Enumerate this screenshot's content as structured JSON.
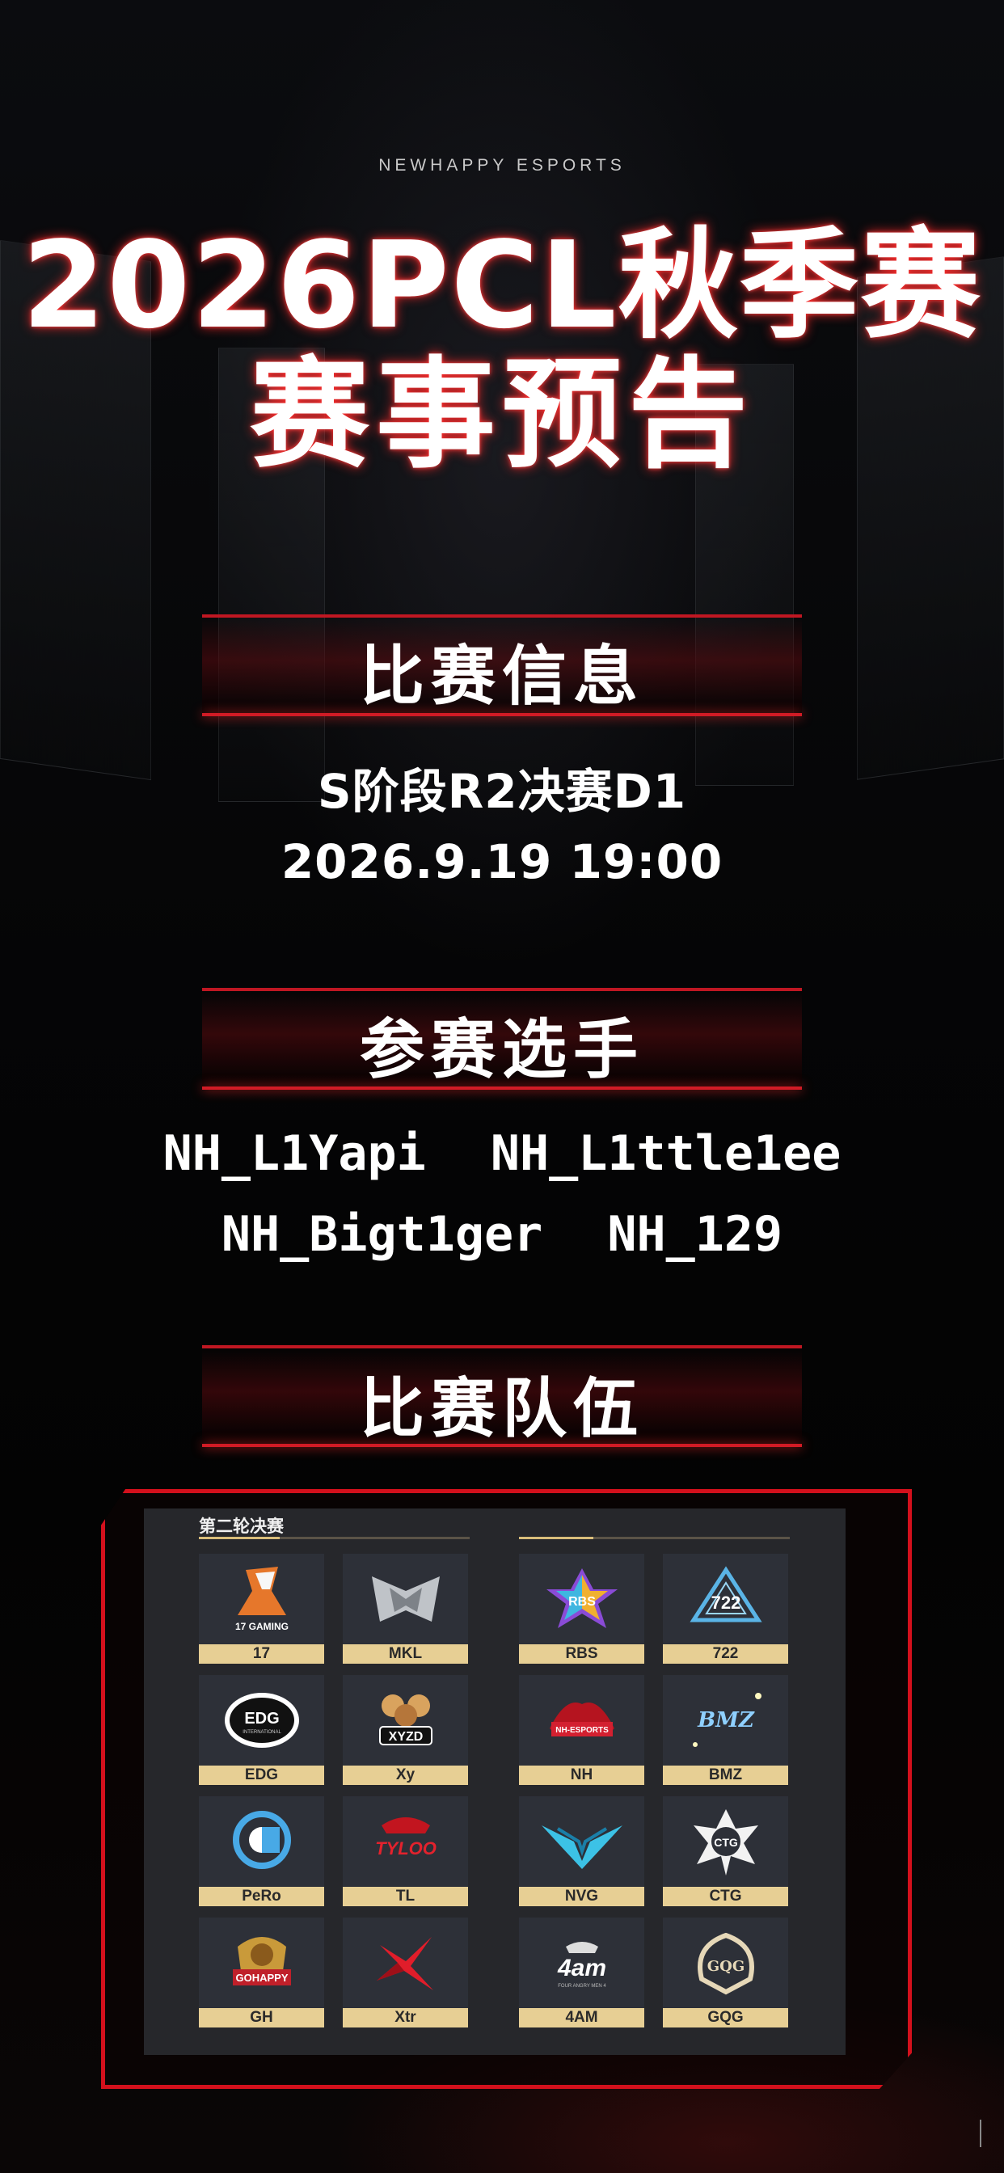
{
  "brand": "NEWHAPPY ESPORTS",
  "title_line1": "2026PCL秋季赛",
  "title_line2": "赛事预告",
  "section_info": {
    "title": "比赛信息",
    "stage": "S阶段R2决赛D1",
    "datetime": "2026.9.19 19:00"
  },
  "section_players": {
    "title": "参赛选手",
    "players": [
      "NH_L1Yapi",
      "NH_L1ttle1ee",
      "NH_Bigt1ger",
      "NH_129"
    ]
  },
  "section_teams": {
    "title": "比赛队伍",
    "board_label": "第二轮决赛",
    "teams": [
      "17",
      "MKL",
      "RBS",
      "722",
      "EDG",
      "Xy",
      "NH",
      "BMZ",
      "PeRo",
      "TL",
      "NVG",
      "CTG",
      "GH",
      "Xtr",
      "4AM",
      "GQG"
    ],
    "logo_texts": {
      "17": "17 GAMING",
      "EDG": "EDG",
      "EDG_sub": "INTERNATIONAL",
      "Xy": "XYZD",
      "RBS": "RBS",
      "722": "722",
      "NH": "NH-ESPORTS",
      "BMZ": "BMZ",
      "TL": "TYLOO",
      "GH": "GOHAPPY",
      "4AM": "4am",
      "4AM_sub": "FOUR ANGRY MEN 4",
      "CTG": "CTG",
      "GQG": "GQG"
    }
  },
  "colors": {
    "accent_red": "#d3101c",
    "name_plate": "#e7cf94",
    "board_bg": "#26272b"
  }
}
